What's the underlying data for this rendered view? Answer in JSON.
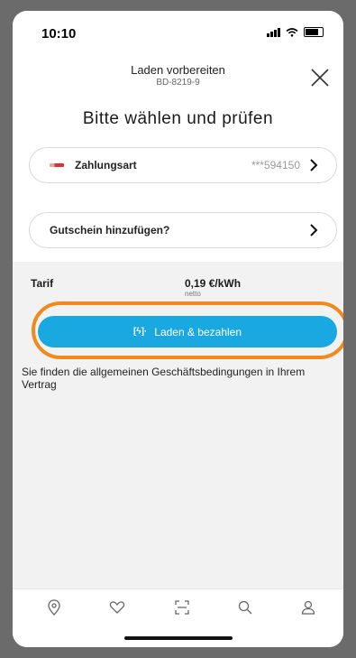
{
  "status": {
    "time": "10:10"
  },
  "header": {
    "title": "Laden vorbereiten",
    "subtitle": "BD-8219-9"
  },
  "main": {
    "headline": "Bitte wählen und prüfen",
    "payment": {
      "label": "Zahlungsart",
      "value": "***594150"
    },
    "voucher": {
      "label": "Gutschein hinzufügen?"
    },
    "tariff": {
      "label": "Tarif",
      "value": "0,19 €/kWh",
      "note": "netto"
    },
    "pay_button": {
      "icon": "[ϟ]·",
      "label": "Laden & bezahlen"
    },
    "terms": "Sie finden die allgemeinen Geschäftsbedingungen in Ihrem Vertrag"
  },
  "tabbar": {
    "items": [
      "map-pin-icon",
      "heart-icon",
      "scan-icon",
      "search-icon",
      "profile-icon"
    ]
  },
  "colors": {
    "accent": "#1aa8e0",
    "highlight": "#f08a1e",
    "card_red": "#e03030"
  }
}
